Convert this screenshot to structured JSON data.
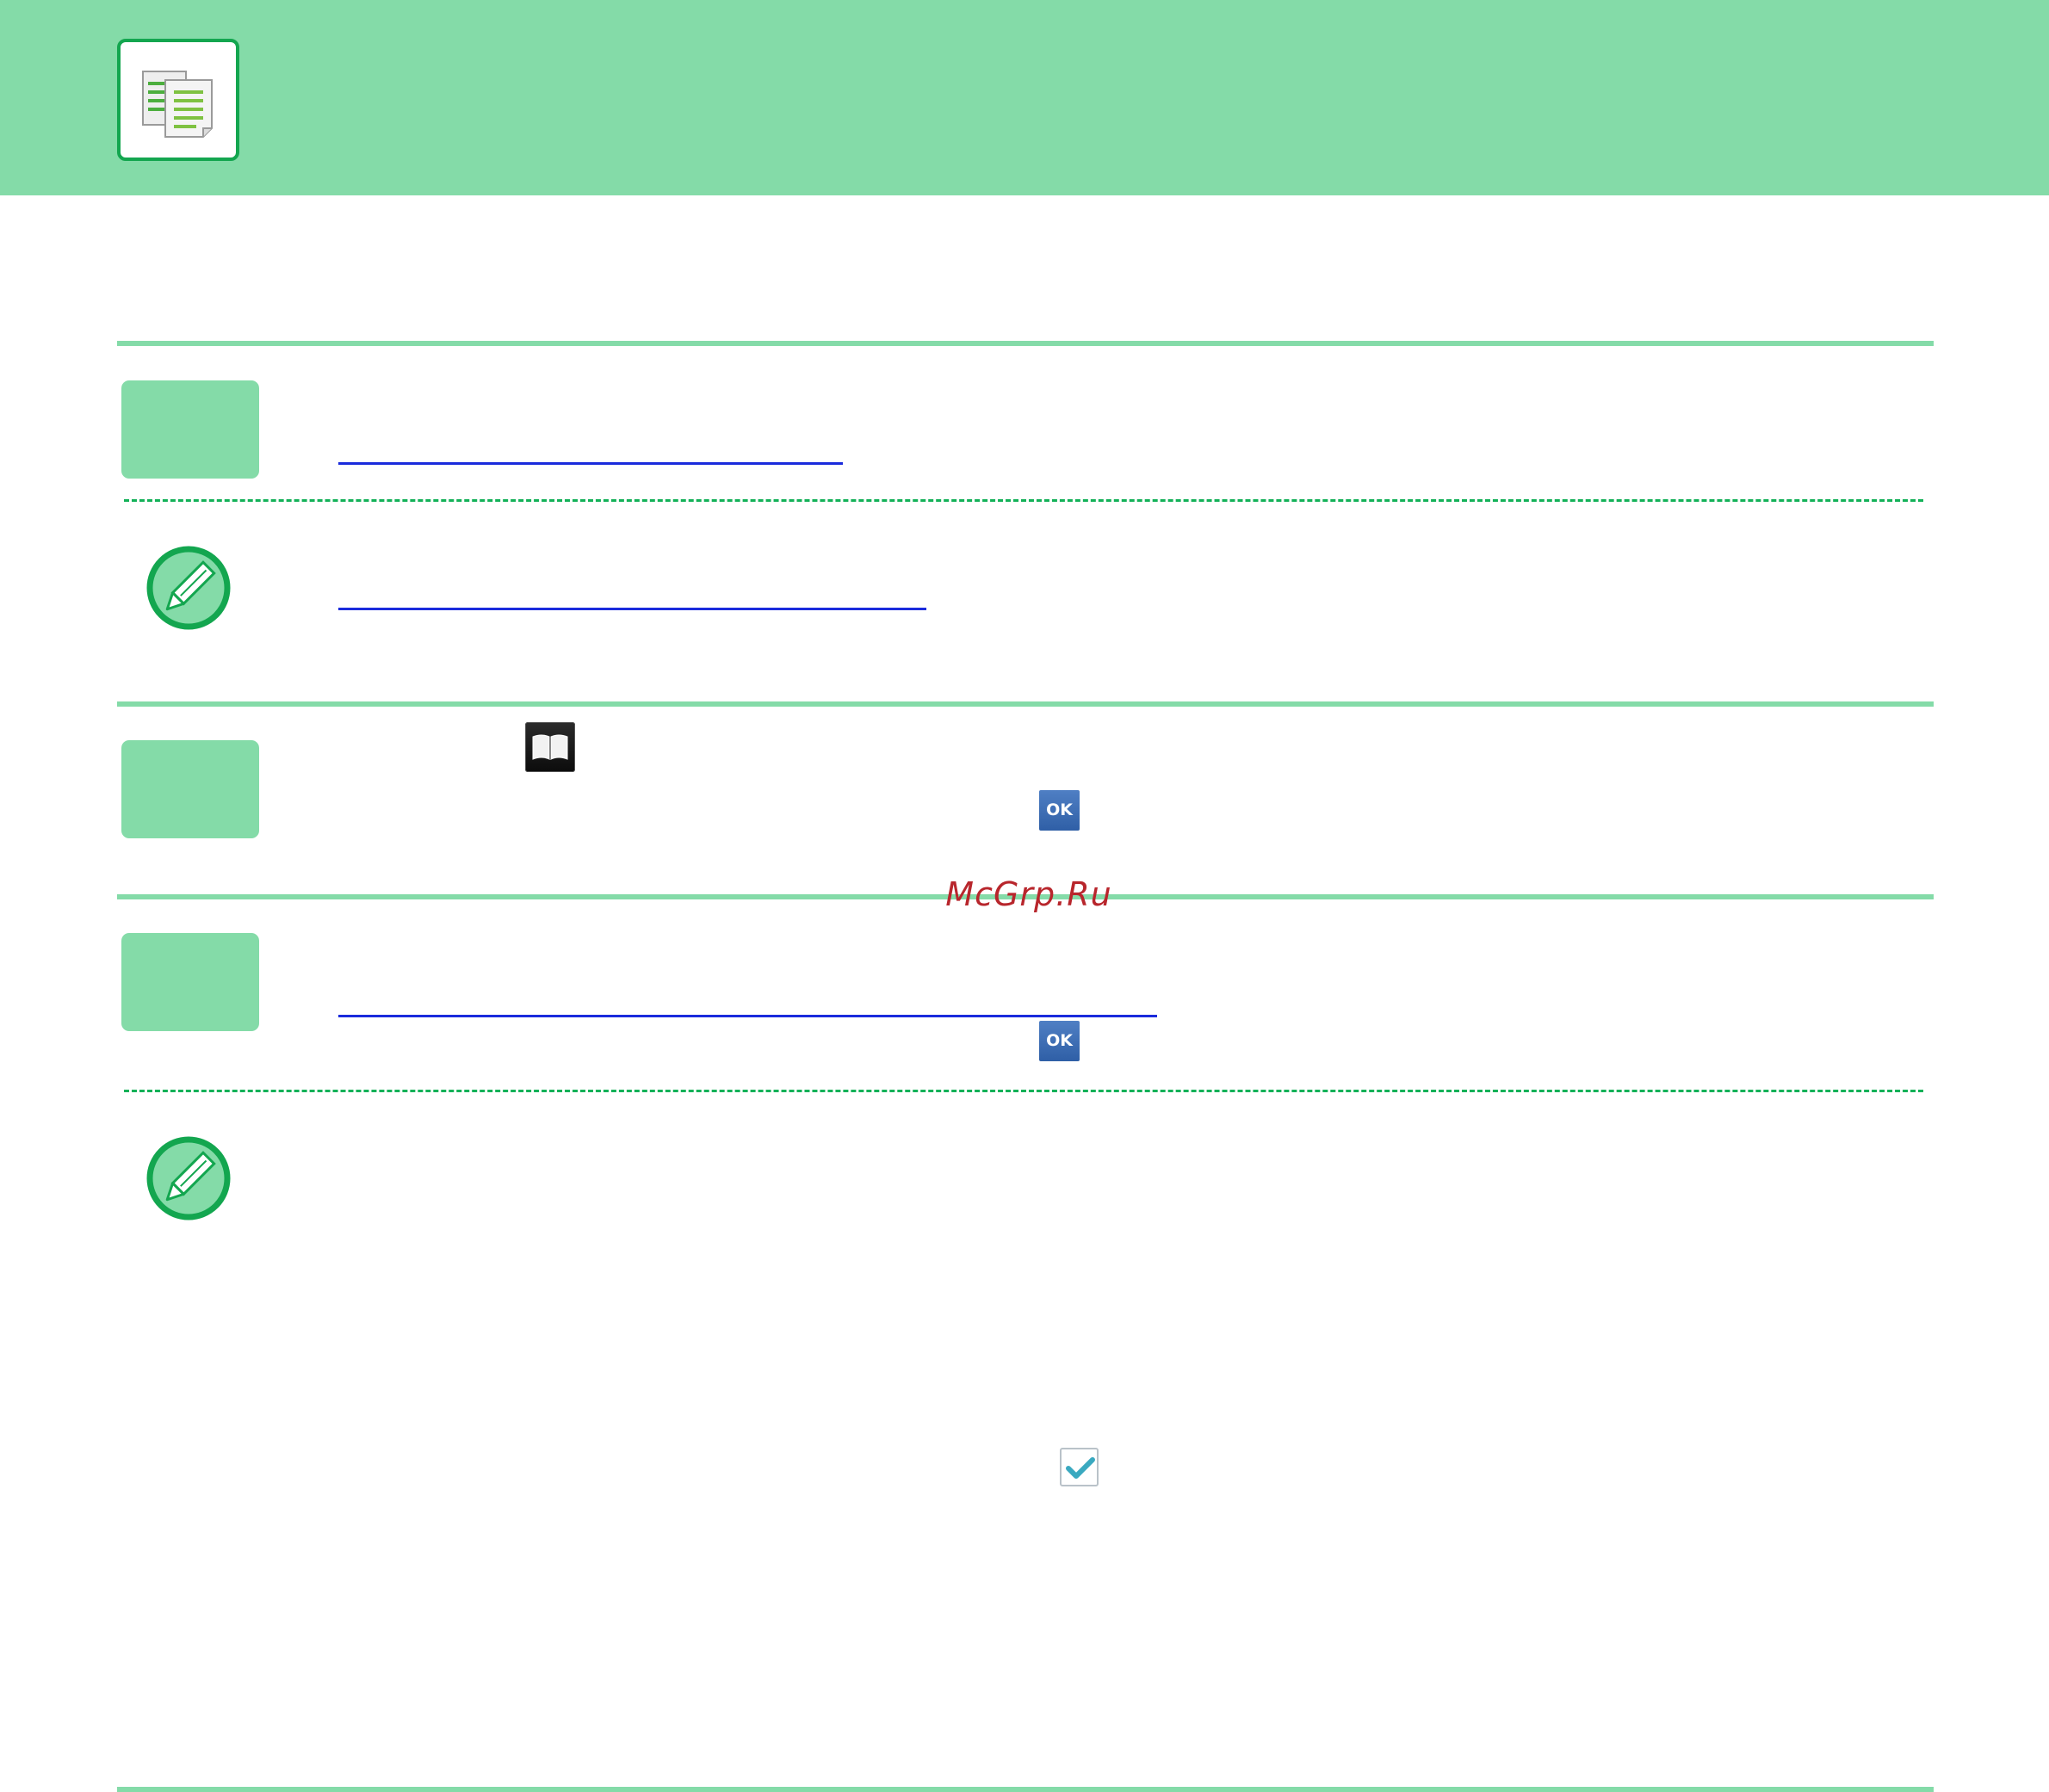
{
  "header": {
    "icon": "copy-icon",
    "band_color": "#84dba8"
  },
  "steps": [
    {
      "id": 1,
      "has_link": true,
      "has_note": true,
      "note_icon": "pencil-note-icon"
    },
    {
      "id": 2,
      "inline_icons": [
        "book-icon",
        "ok-key"
      ]
    },
    {
      "id": 3,
      "has_link": true,
      "inline_icons": [
        "ok-key"
      ],
      "has_note": true,
      "note_icon": "pencil-note-icon"
    }
  ],
  "keys": {
    "ok_label": "OK"
  },
  "note_extra": {
    "checkbox_state": "checked"
  },
  "watermark": {
    "text": "McGrp.Ru"
  },
  "colors": {
    "accent_green": "#84dba8",
    "dark_green": "#13a64f",
    "link_blue": "#1a2bdc",
    "ok_blue": "#3a6cb4",
    "watermark_red": "#b8262c"
  }
}
